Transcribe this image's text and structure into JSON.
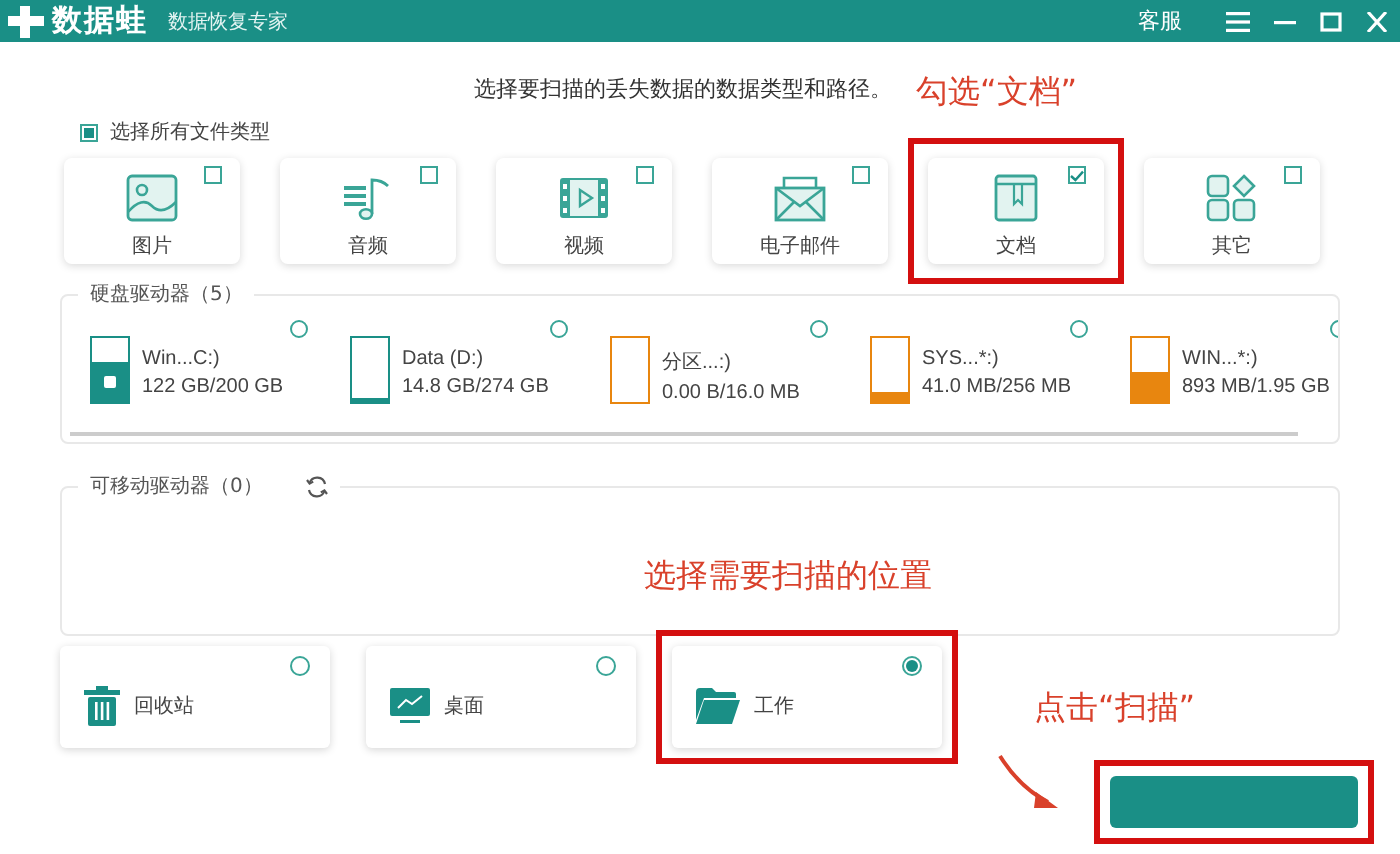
{
  "header": {
    "logo": "数据蛙",
    "tagline": "数据恢复专家",
    "support": "客服"
  },
  "instruction": "选择要扫描的丢失数据的数据类型和路径。",
  "select_all": {
    "label": "选择所有文件类型",
    "checked": true
  },
  "file_types": [
    {
      "kind": "image",
      "label": "图片",
      "checked": false,
      "highlighted": false
    },
    {
      "kind": "audio",
      "label": "音频",
      "checked": false,
      "highlighted": false
    },
    {
      "kind": "video",
      "label": "视频",
      "checked": false,
      "highlighted": false
    },
    {
      "kind": "email",
      "label": "电子邮件",
      "checked": false,
      "highlighted": false
    },
    {
      "kind": "document",
      "label": "文档",
      "checked": true,
      "highlighted": true
    },
    {
      "kind": "other",
      "label": "其它",
      "checked": false,
      "highlighted": false
    }
  ],
  "hard_drives": {
    "title": "硬盘驱动器（5）",
    "drives": [
      {
        "name": "Win...C:)",
        "size": "122 GB/200 GB",
        "level": 0.61,
        "color": "#1a8f86",
        "system": true,
        "selected": false
      },
      {
        "name": "Data (D:)",
        "size": "14.8 GB/274 GB",
        "level": 0.05,
        "color": "#1a8f86",
        "system": false,
        "selected": false
      },
      {
        "name": "分区...:)",
        "size": "0.00  B/16.0 MB",
        "level": 0,
        "color": "#e8860f",
        "system": false,
        "selected": false
      },
      {
        "name": "SYS...*:)",
        "size": "41.0 MB/256 MB",
        "level": 0.16,
        "color": "#e8860f",
        "system": false,
        "selected": false
      },
      {
        "name": "WIN...*:)",
        "size": "893 MB/1.95 GB",
        "level": 0.46,
        "color": "#e8860f",
        "system": false,
        "selected": false
      }
    ]
  },
  "removable_drives": {
    "title": "可移动驱动器（0）"
  },
  "locations": [
    {
      "kind": "recycle_bin",
      "label": "回收站",
      "selected": false,
      "highlighted": false
    },
    {
      "kind": "desktop",
      "label": "桌面",
      "selected": false,
      "highlighted": false
    },
    {
      "kind": "folder",
      "label": "工作",
      "selected": true,
      "highlighted": true
    }
  ],
  "scan_button": {
    "highlighted": true
  },
  "annotations": [
    {
      "text": "勾选“文档”"
    },
    {
      "text": "选择需要扫描的位置"
    },
    {
      "text": "点击“扫描”"
    }
  ]
}
